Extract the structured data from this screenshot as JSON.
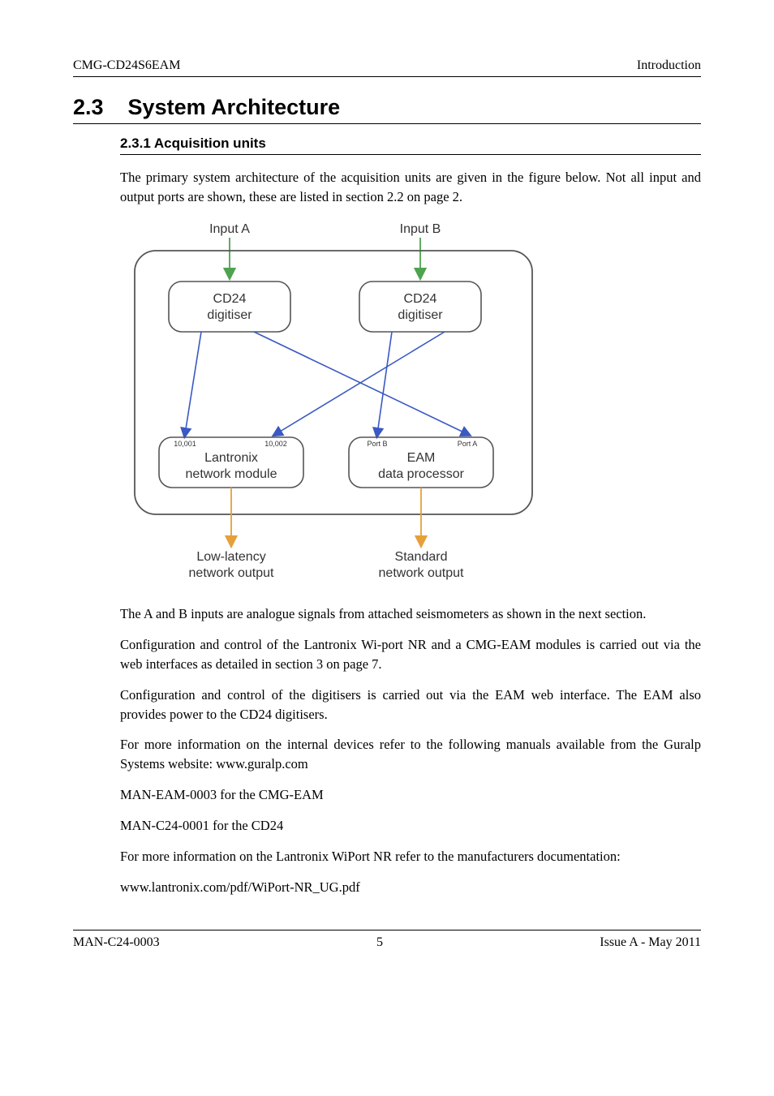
{
  "header": {
    "left": "CMG-CD24S6EAM",
    "right": "Introduction"
  },
  "section": {
    "number": "2.3",
    "title": "System Architecture"
  },
  "subsection": {
    "title": "2.3.1 Acquisition units"
  },
  "paragraphs": {
    "p1": "The primary system architecture of the acquisition units are given in the figure below.  Not all input and output ports are shown, these are listed in section 2.2 on page 2.",
    "p2": "The A and B inputs are analogue signals from attached seismometers as shown in the next section.",
    "p3": "Configuration and control of the Lantronix Wi-port NR and a CMG-EAM modules is carried out via the web interfaces as detailed in section 3 on page 7.",
    "p4": "Configuration and control of the digitisers is carried out via the EAM web interface.  The EAM also provides power to the CD24 digitisers.",
    "p5": "For more information on the internal devices refer to the following manuals available from the  Guralp Systems website: www.guralp.com",
    "p6": "MAN-EAM-0003 for the CMG-EAM",
    "p7": "MAN-C24-0001 for the CD24",
    "p8": "For more information on the Lantronix WiPort NR refer to the manufacturers documentation:",
    "p9": "www.lantronix.com/pdf/WiPort-NR_UG.pdf"
  },
  "diagram": {
    "inputA": "Input A",
    "inputB": "Input B",
    "cd24_a_line1": "CD24",
    "cd24_a_line2": "digitiser",
    "cd24_b_line1": "CD24",
    "cd24_b_line2": "digitiser",
    "port10001": "10,001",
    "port10002": "10,002",
    "portA": "Port A",
    "portB": "Port B",
    "lantronix_line1": "Lantronix",
    "lantronix_line2": "network module",
    "eam_line1": "EAM",
    "eam_line2": "data processor",
    "outLow_line1": "Low-latency",
    "outLow_line2": "network output",
    "outStd_line1": "Standard",
    "outStd_line2": "network output"
  },
  "footer": {
    "left": "MAN-C24-0003",
    "center": "5",
    "right": "Issue A  - May 2011"
  }
}
